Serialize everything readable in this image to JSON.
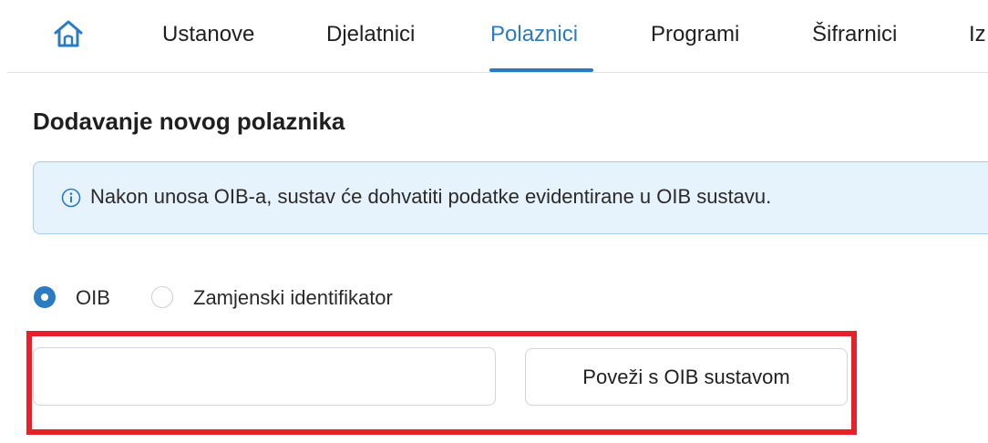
{
  "nav": {
    "home_icon": "home-icon",
    "items": [
      {
        "label": "Ustanove",
        "active": false
      },
      {
        "label": "Djelatnici",
        "active": false
      },
      {
        "label": "Polaznici",
        "active": true
      },
      {
        "label": "Programi",
        "active": false
      },
      {
        "label": "Šifrarnici",
        "active": false
      },
      {
        "label": "Iz",
        "active": false
      }
    ]
  },
  "page": {
    "title": "Dodavanje novog polaznika"
  },
  "alert": {
    "icon": "info-icon",
    "text": "Nakon unosa OIB-a, sustav će dohvatiti podatke evidentirane u OIB sustavu."
  },
  "identifier_type": {
    "options": [
      {
        "label": "OIB",
        "selected": true
      },
      {
        "label": "Zamjenski identifikator",
        "selected": false
      }
    ]
  },
  "oib_field": {
    "value": "",
    "placeholder": ""
  },
  "connect_button": {
    "label": "Poveži s OIB sustavom"
  },
  "colors": {
    "accent": "#2b7bc2",
    "alert_background": "#e6f2fc",
    "alert_border": "#a9cdee",
    "highlight": "#e8202a"
  }
}
